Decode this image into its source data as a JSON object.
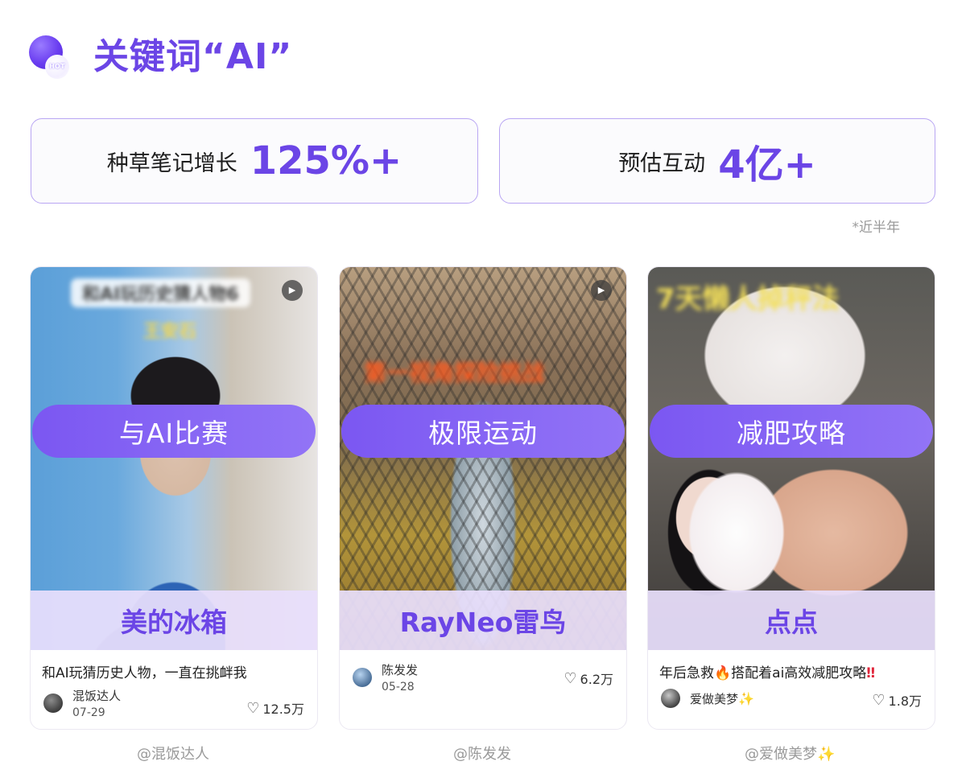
{
  "header": {
    "badge_text": "HOT",
    "title": "关键词“AI”"
  },
  "stats": [
    {
      "label": "种草笔记增长",
      "value": "125%+"
    },
    {
      "label": "预估互动",
      "value": "4亿+"
    }
  ],
  "note": "*近半年",
  "cards": [
    {
      "media_text_1": "和AI玩历史猜人物6",
      "media_text_2": "王安石",
      "play_icon": "play-icon",
      "pill": "与AI比赛",
      "brand": "美的冰箱",
      "caption": "和AI玩猜历史人物，一直在挑衅我",
      "author": "混饭达人",
      "date": "07-29",
      "likes": "12.5万",
      "handle": "@混饭达人"
    },
    {
      "media_text_1": "第一视角探险挑战",
      "play_icon": "play-icon",
      "pill": "极限运动",
      "brand": "RayNeo雷鸟",
      "caption": "",
      "author": "陈发发",
      "date": "05-28",
      "likes": "6.2万",
      "handle": "@陈发发"
    },
    {
      "media_text_1": "7天懒人掉秤法",
      "pill": "减肥攻略",
      "brand": "点点",
      "caption_parts": {
        "a": "年后急救",
        "fire": "🔥",
        "b": "搭配着ai高效减肥攻略",
        "bang": "‼"
      },
      "author": "爱做美梦",
      "author_emoji": "✨",
      "likes": "1.8万",
      "handle": "@爱做美梦",
      "handle_emoji": "✨"
    }
  ],
  "colors": {
    "accent": "#6b45e6",
    "pill": "#7b57f2",
    "border": "#b9a6f3"
  },
  "icons": {
    "heart": "heart-icon",
    "hot": "hot-badge-icon"
  }
}
